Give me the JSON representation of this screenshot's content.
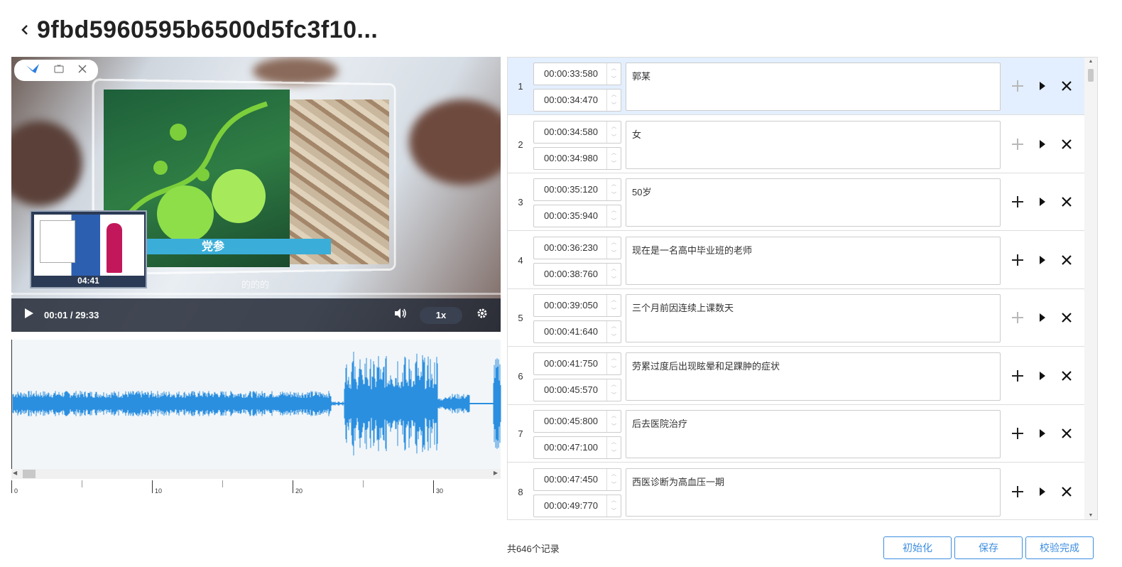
{
  "header": {
    "title": "9fbd5960595b6500d5fc3f10..."
  },
  "video": {
    "mini_time": "04:41",
    "caption": "党参",
    "ghost_subtitle": "的的的",
    "current_time": "00:01 / 29:33",
    "speed": "1x",
    "progress": 0.003
  },
  "waveform": {
    "ruler_labels": [
      "0",
      "10",
      "20",
      "30"
    ]
  },
  "segments": [
    {
      "index": "1",
      "start": "00:00:33:580",
      "end": "00:00:34:470",
      "text": "郭某",
      "selected": true
    },
    {
      "index": "2",
      "start": "00:00:34:580",
      "end": "00:00:34:980",
      "text": "女",
      "selected": false
    },
    {
      "index": "3",
      "start": "00:00:35:120",
      "end": "00:00:35:940",
      "text": "50岁",
      "selected": false
    },
    {
      "index": "4",
      "start": "00:00:36:230",
      "end": "00:00:38:760",
      "text": "现在是一名高中毕业班的老师",
      "selected": false
    },
    {
      "index": "5",
      "start": "00:00:39:050",
      "end": "00:00:41:640",
      "text": "三个月前因连续上课数天",
      "selected": false
    },
    {
      "index": "6",
      "start": "00:00:41:750",
      "end": "00:00:45:570",
      "text": "劳累过度后出现眩晕和足踝肿的症状",
      "selected": false
    },
    {
      "index": "7",
      "start": "00:00:45:800",
      "end": "00:00:47:100",
      "text": "后去医院治疗",
      "selected": false
    },
    {
      "index": "8",
      "start": "00:00:47:450",
      "end": "00:00:49:770",
      "text": "西医诊断为高血压一期",
      "selected": false
    }
  ],
  "footer": {
    "count": "共646个记录",
    "init_label": "初始化",
    "save_label": "保存",
    "verify_label": "校验完成"
  },
  "colors": {
    "accent": "#3d8ee0",
    "wave": "#2b8fe0",
    "selected_row": "#e3efff"
  }
}
